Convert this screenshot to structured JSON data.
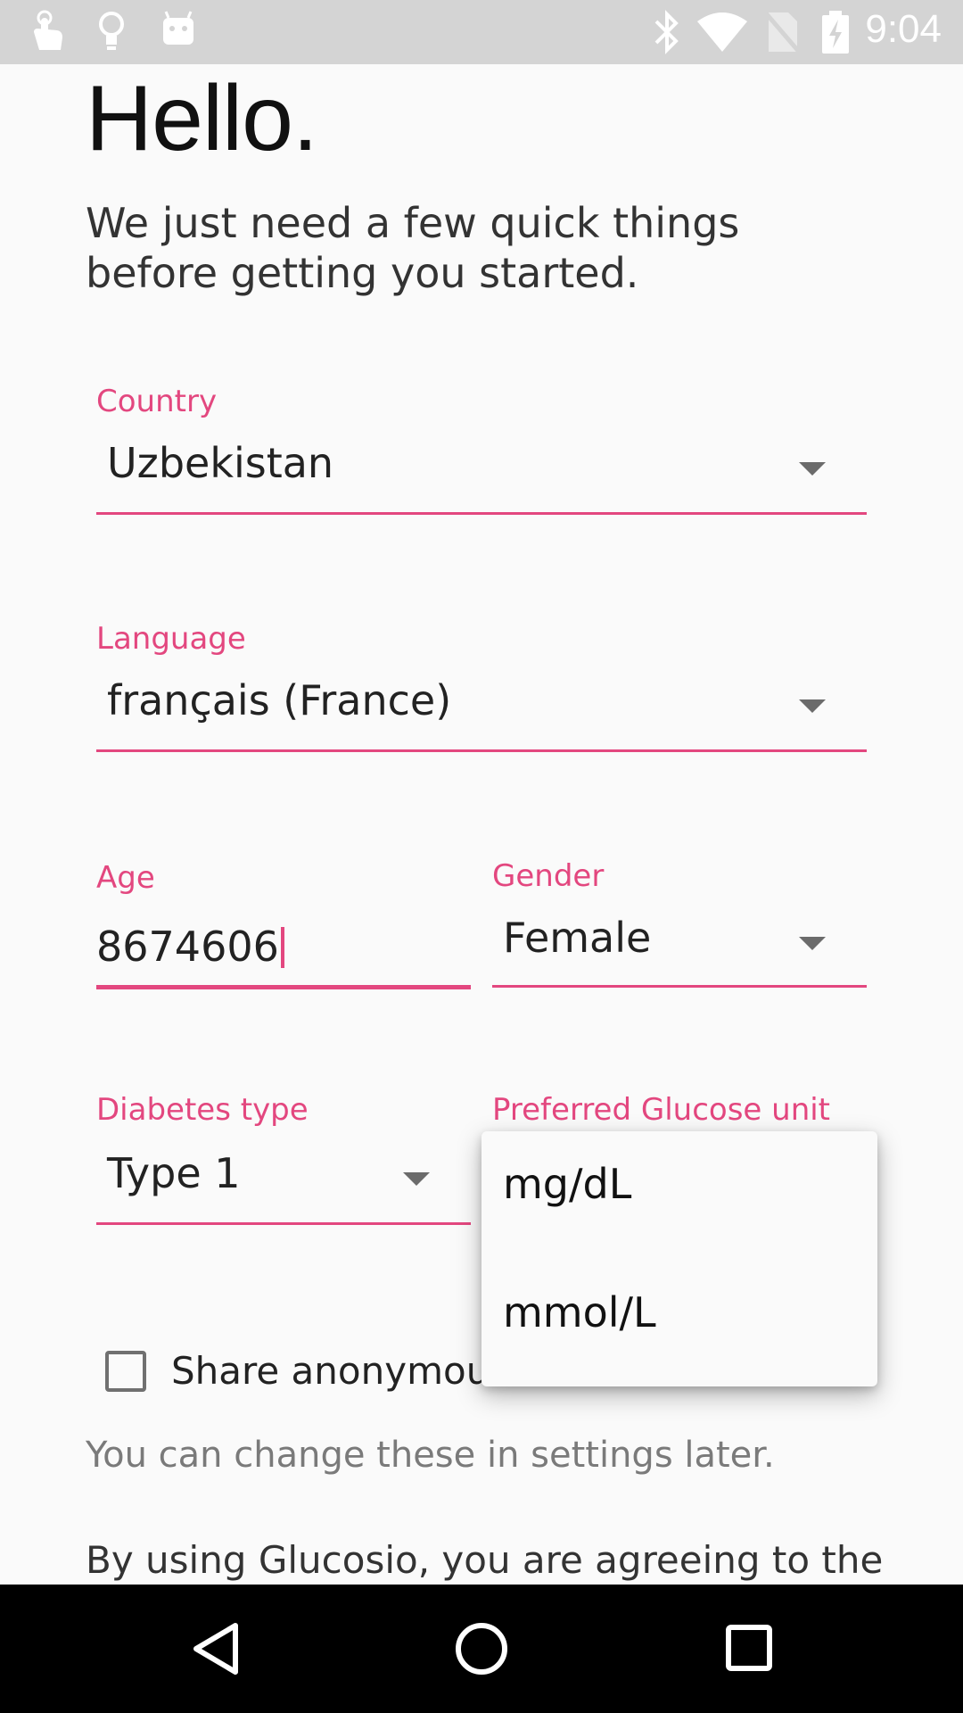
{
  "status_bar": {
    "time": "9:04",
    "left_icons": [
      "touch-icon",
      "lightbulb-icon",
      "android-icon"
    ],
    "right_icons": [
      "bluetooth-icon",
      "wifi-icon",
      "no-sim-icon",
      "battery-charging-icon"
    ]
  },
  "header": {
    "title": "Hello.",
    "intro": "We just need a few quick things before getting you started."
  },
  "form": {
    "country": {
      "label": "Country",
      "value": "Uzbekistan"
    },
    "language": {
      "label": "Language",
      "value": "français (France)"
    },
    "age": {
      "label": "Age",
      "value": "8674606"
    },
    "gender": {
      "label": "Gender",
      "value": "Female"
    },
    "diabetes_type": {
      "label": "Diabetes type",
      "value": "Type 1"
    },
    "glucose_unit": {
      "label": "Preferred Glucose unit",
      "options": [
        "mg/dL",
        "mmol/L"
      ]
    },
    "share": {
      "label": "Share anonymous d",
      "checked": false
    }
  },
  "footer": {
    "hint": "You can change these in settings later.",
    "terms": "By using Glucosio, you are agreeing to the"
  },
  "colors": {
    "accent": "#e3477f",
    "status_bar": "#d4d4d4",
    "nav_bar": "#000000",
    "background": "#fafafa"
  },
  "nav_bar": {
    "buttons": [
      "back-icon",
      "home-icon",
      "recents-icon"
    ]
  }
}
